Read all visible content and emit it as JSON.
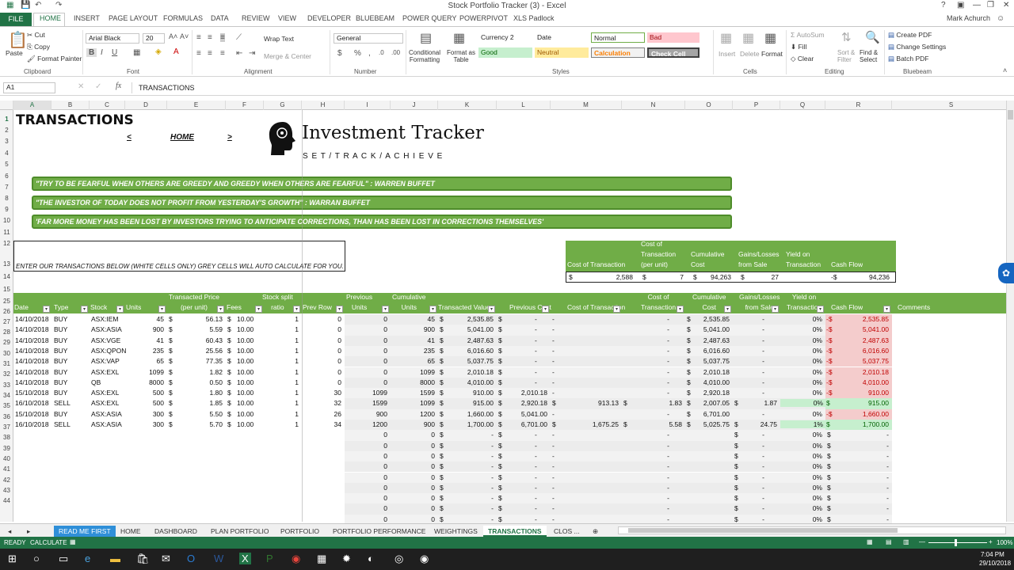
{
  "window": {
    "title": "Stock Portfolio Tracker (3) - Excel",
    "user": "Mark Achurch"
  },
  "tabs": [
    "FILE",
    "HOME",
    "INSERT",
    "PAGE LAYOUT",
    "FORMULAS",
    "DATA",
    "REVIEW",
    "VIEW",
    "DEVELOPER",
    "BLUEBEAM",
    "POWER QUERY",
    "POWERPIVOT",
    "XLS Padlock"
  ],
  "ribbon": {
    "paste": "Paste",
    "cut": "Cut",
    "copy": "Copy",
    "format_painter": "Format Painter",
    "clipboard": "Clipboard",
    "font_name": "Arial Black",
    "font_size": "20",
    "font": "Font",
    "wrap_text": "Wrap Text",
    "merge_center": "Merge & Center",
    "alignment": "Alignment",
    "number_format": "General",
    "number": "Number",
    "conditional": "Conditional\nFormatting",
    "format_as_table": "Format as\nTable",
    "styles": [
      "Currency 2",
      "Date",
      "Normal",
      "Bad",
      "Good",
      "Neutral",
      "Calculation",
      "Check Cell"
    ],
    "styles_group": "Styles",
    "insert": "Insert",
    "delete": "Delete",
    "format": "Format",
    "cells": "Cells",
    "autosum": "AutoSum",
    "fill": "Fill",
    "clear": "Clear",
    "sort_filter": "Sort &\nFilter",
    "find_select": "Find &\nSelect",
    "editing": "Editing",
    "create_pdf": "Create PDF",
    "change_settings": "Change Settings",
    "batch_pdf": "Batch PDF",
    "bluebeam": "Bluebeam"
  },
  "formula_bar": {
    "name_box": "A1",
    "formula": "TRANSACTIONS"
  },
  "columns": [
    "A",
    "B",
    "C",
    "D",
    "E",
    "F",
    "G",
    "H",
    "I",
    "J",
    "K",
    "L",
    "M",
    "N",
    "O",
    "P",
    "Q",
    "R",
    "S"
  ],
  "rows": [
    "1",
    "2",
    "3",
    "4",
    "5",
    "6",
    "7",
    "8",
    "9",
    "10",
    "11",
    "12",
    "13",
    "14",
    "15",
    "25",
    "26",
    "27",
    "28",
    "29",
    "30",
    "31",
    "32",
    "33",
    "34",
    "35",
    "36",
    "37",
    "38",
    "39",
    "40",
    "41",
    "42",
    "43",
    "44"
  ],
  "sheet": {
    "title": "TRANSACTIONS",
    "nav_prev": "<",
    "nav_home": "HOME",
    "nav_next": ">",
    "brand_title": "Investment Tracker",
    "brand_sub": "S E T  /  T R A C K  /  A C H I E V E",
    "quotes": [
      "\"TRY TO BE FEARFUL WHEN OTHERS ARE GREEDY AND GREEDY WHEN OTHERS ARE FEARFUL\" : WARREN BUFFET",
      "\"THE INVESTOR OF TODAY DOES NOT PROFIT FROM YESTERDAY'S GROWTH\" : WARRAN BUFFET",
      "'FAR MORE MONEY HAS BEEN LOST BY INVESTORS TRYING TO ANTICIPATE CORRECTIONS, THAN HAS BEEN LOST IN CORRECTIONS THEMSELVES'"
    ],
    "instruction": "ENTER OUR TRANSACTIONS BELOW (WHITE CELLS ONLY) GREY CELLS WILL AUTO CALCULATE FOR YOU.",
    "summary_headers": [
      "Cost of Transaction",
      "Cost of\nTransaction\n(per unit)",
      "Cumulative\nCost",
      "Gains/Losses\nfrom Sale",
      "Yield on\nTransaction",
      "Cash Flow"
    ],
    "summary_values": [
      "$",
      "2,588",
      "$",
      "7",
      "$",
      "94,263",
      "$",
      "27",
      "",
      "-$",
      "94,236"
    ],
    "headers": [
      "Date",
      "Type",
      "Stock",
      "Units",
      "Transacted Price\n(per unit)",
      "Fees",
      "Stock split\nratio",
      "Prev Row",
      "Previous\nUnits",
      "Cumulative\nUnits",
      "Transacted Value",
      "Previous Cost",
      "Cost of Transaction",
      "Cost of\nTransaction",
      "Cumulative\nCost",
      "Gains/Losses\nfrom Sale",
      "Yield on\nTransaction",
      "Cash Flow",
      "Comments"
    ],
    "data": [
      [
        "14/10/2018",
        "BUY",
        "ASX:IEM",
        "45",
        "56.13",
        "10.00",
        "1",
        "0",
        "0",
        "45",
        "2,535.85",
        "-",
        "-",
        "-",
        "2,535.85",
        "-",
        "0%",
        "2,535.85"
      ],
      [
        "14/10/2018",
        "BUY",
        "ASX:ASIA",
        "900",
        "5.59",
        "10.00",
        "1",
        "0",
        "0",
        "900",
        "5,041.00",
        "-",
        "-",
        "-",
        "5,041.00",
        "-",
        "0%",
        "5,041.00"
      ],
      [
        "14/10/2018",
        "BUY",
        "ASX:VGE",
        "41",
        "60.43",
        "10.00",
        "1",
        "0",
        "0",
        "41",
        "2,487.63",
        "-",
        "-",
        "-",
        "2,487.63",
        "-",
        "0%",
        "2,487.63"
      ],
      [
        "14/10/2018",
        "BUY",
        "ASX:QPON",
        "235",
        "25.56",
        "10.00",
        "1",
        "0",
        "0",
        "235",
        "6,016.60",
        "-",
        "-",
        "-",
        "6,016.60",
        "-",
        "0%",
        "6,016.60"
      ],
      [
        "14/10/2018",
        "BUY",
        "ASX:VAP",
        "65",
        "77.35",
        "10.00",
        "1",
        "0",
        "0",
        "65",
        "5,037.75",
        "-",
        "-",
        "-",
        "5,037.75",
        "-",
        "0%",
        "5,037.75"
      ],
      [
        "14/10/2018",
        "BUY",
        "ASX:EXL",
        "1099",
        "1.82",
        "10.00",
        "1",
        "0",
        "0",
        "1099",
        "2,010.18",
        "-",
        "-",
        "-",
        "2,010.18",
        "-",
        "0%",
        "2,010.18"
      ],
      [
        "14/10/2018",
        "BUY",
        "QB",
        "8000",
        "0.50",
        "10.00",
        "1",
        "0",
        "0",
        "8000",
        "4,010.00",
        "-",
        "-",
        "-",
        "4,010.00",
        "-",
        "0%",
        "4,010.00"
      ],
      [
        "15/10/2018",
        "BUY",
        "ASX:EXL",
        "500",
        "1.80",
        "10.00",
        "1",
        "30",
        "1099",
        "1599",
        "910.00",
        "2,010.18",
        "-",
        "-",
        "2,920.18",
        "-",
        "0%",
        "910.00"
      ],
      [
        "16/10/2018",
        "SELL",
        "ASX:EXL",
        "500",
        "1.85",
        "10.00",
        "1",
        "32",
        "1599",
        "1099",
        "915.00",
        "2,920.18",
        "913.13",
        "1.83",
        "2,007.05",
        "1.87",
        "0%",
        "915.00"
      ],
      [
        "15/10/2018",
        "BUY",
        "ASX:ASIA",
        "300",
        "5.50",
        "10.00",
        "1",
        "26",
        "900",
        "1200",
        "1,660.00",
        "5,041.00",
        "-",
        "-",
        "6,701.00",
        "-",
        "0%",
        "1,660.00"
      ],
      [
        "16/10/2018",
        "SELL",
        "ASX:ASIA",
        "300",
        "5.70",
        "10.00",
        "1",
        "34",
        "1200",
        "900",
        "1,700.00",
        "6,701.00",
        "1,675.25",
        "5.58",
        "5,025.75",
        "24.75",
        "1%",
        "1,700.00"
      ]
    ],
    "empty_vals": {
      "units": "0",
      "cum": "0",
      "dash": "-",
      "pct": "0%"
    }
  },
  "sheet_tabs": [
    "READ ME FIRST",
    "HOME",
    "DASHBOARD",
    "PLAN PORTFOLIO",
    "PORTFOLIO",
    "PORTFOLIO PERFORMANCE",
    "WEIGHTINGS",
    "TRANSACTIONS",
    "CLOS ..."
  ],
  "status": {
    "ready": "READY",
    "calculate": "CALCULATE",
    "zoom": "100%"
  },
  "taskbar": {
    "time": "7:04 PM",
    "date": "29/10/2018"
  },
  "colors": {
    "excel_green": "#217346",
    "band_green": "#70ad47",
    "neg_red": "#f4cccc",
    "pos_green": "#c6efce"
  }
}
